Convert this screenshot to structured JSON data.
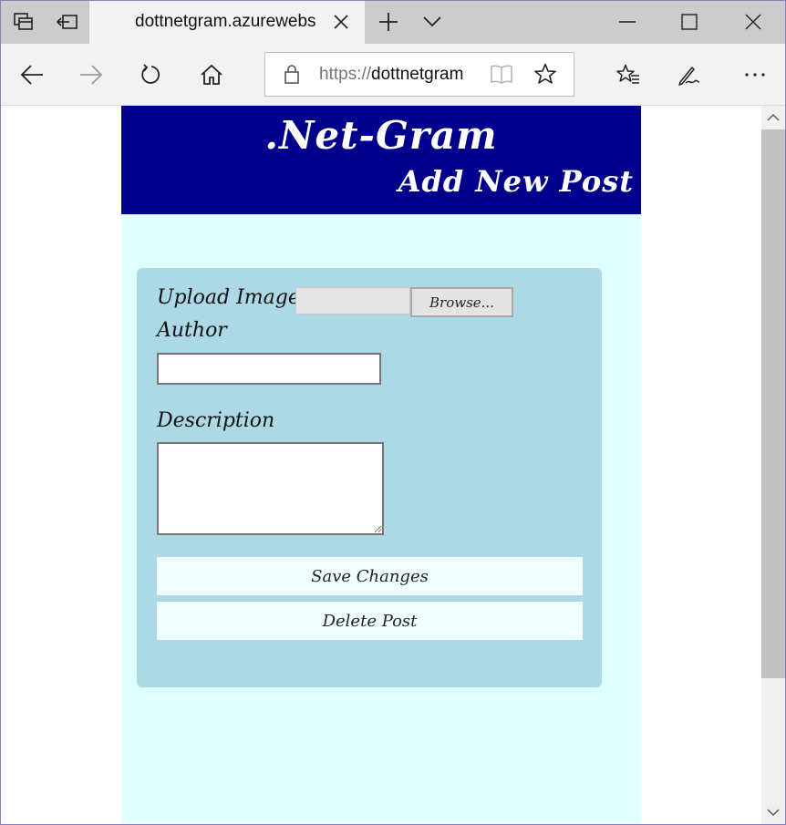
{
  "browser": {
    "tab": {
      "title": "dottnetgram.azurewebs"
    },
    "address": {
      "scheme": "https://",
      "host": "dottnetgram"
    }
  },
  "site": {
    "title": ".Net-Gram",
    "subtitle": "Add New Post"
  },
  "form": {
    "upload_label": "Upload Image",
    "browse_label": "Browse...",
    "author_label": "Author",
    "author_value": "",
    "description_label": "Description",
    "description_value": "",
    "save_label": "Save Changes",
    "delete_label": "Delete Post"
  },
  "colors": {
    "header_bg": "#00008b",
    "page_bg": "#e0ffff",
    "card_bg": "#add8e6",
    "button_bg": "#f0ffff"
  },
  "icons": [
    "tab-actions-icon",
    "set-aside-tabs-icon",
    "close-icon",
    "new-tab-icon",
    "tab-list-chevron-icon",
    "minimize-icon",
    "maximize-icon",
    "window-close-icon",
    "back-icon",
    "forward-icon",
    "refresh-icon",
    "home-icon",
    "lock-icon",
    "reading-view-icon",
    "favorite-star-icon",
    "favorites-list-icon",
    "web-notes-icon",
    "more-icon"
  ]
}
